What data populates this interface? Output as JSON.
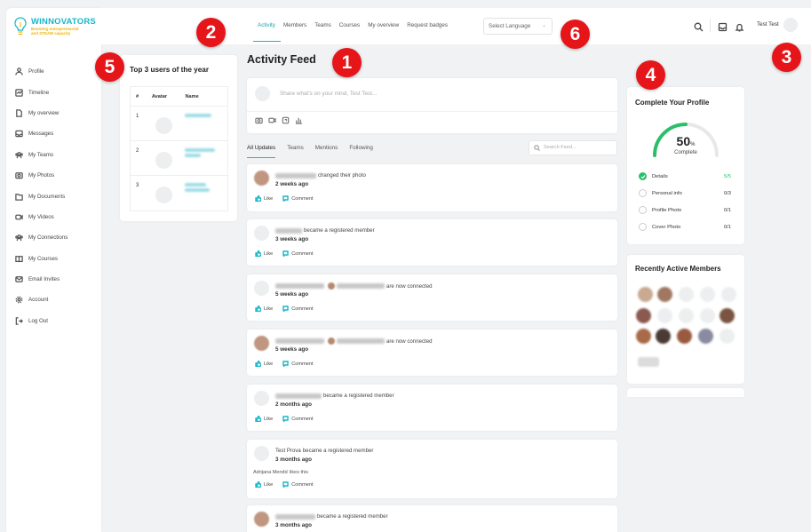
{
  "brand": {
    "name": "WINNOVATORS",
    "tagline": "Boosting entrepreneurial and STEAM capacity",
    "color": "#19b6c9",
    "accent": "#f2b400"
  },
  "sidebar": {
    "items": [
      {
        "label": "Profile",
        "icon": "user-icon"
      },
      {
        "label": "Timeline",
        "icon": "timeline-icon"
      },
      {
        "label": "My overview",
        "icon": "document-icon"
      },
      {
        "label": "Messages",
        "icon": "inbox-icon"
      },
      {
        "label": "My Teams",
        "icon": "teams-icon"
      },
      {
        "label": "My Photos",
        "icon": "photos-icon"
      },
      {
        "label": "My Documents",
        "icon": "folder-icon"
      },
      {
        "label": "My Videos",
        "icon": "video-icon"
      },
      {
        "label": "My Connections",
        "icon": "connections-icon"
      },
      {
        "label": "My Courses",
        "icon": "book-icon"
      },
      {
        "label": "Email Invites",
        "icon": "mail-icon"
      },
      {
        "label": "Account",
        "icon": "gear-icon"
      },
      {
        "label": "Log Out",
        "icon": "logout-icon"
      }
    ]
  },
  "topnav": {
    "tabs": [
      "Activity",
      "Members",
      "Teams",
      "Courses",
      "My overview",
      "Request badges"
    ],
    "active": "Activity",
    "language_placeholder": "Select Language",
    "user_name": "Test Test"
  },
  "badges": [
    "1",
    "2",
    "3",
    "4",
    "5",
    "6"
  ],
  "top_users": {
    "title": "Top 3 users of the year",
    "headers": [
      "#",
      "Avatar",
      "Name"
    ],
    "ranks": [
      "1",
      "2",
      "3"
    ]
  },
  "feed": {
    "title": "Activity Feed",
    "composer_placeholder": "Share what's on your mind, Test Test...",
    "subtabs": [
      "All Updates",
      "Teams",
      "Mentions",
      "Following"
    ],
    "search_placeholder": "Search Feed...",
    "like_label": "Like",
    "comment_label": "Comment",
    "posts": [
      {
        "action": "changed their photo",
        "time": "2 weeks ago"
      },
      {
        "action": "became a registered member",
        "time": "3 weeks ago"
      },
      {
        "action": "are now connected",
        "time": "5 weeks ago"
      },
      {
        "action": "are now connected",
        "time": "5 weeks ago"
      },
      {
        "action": "became a registered member",
        "time": "2 months ago"
      },
      {
        "name": "Test Prova",
        "action": "became a registered member",
        "time": "3 months ago",
        "likes": "Adrijana Mendić likes this"
      },
      {
        "action": "became a registered member",
        "time": "3 months ago"
      }
    ]
  },
  "profile_completion": {
    "title": "Complete Your Profile",
    "percent": 50,
    "percent_sign": "%",
    "complete_label": "Complete",
    "gauge_color": "#2bbf6a",
    "rows": [
      {
        "label": "Details",
        "value": "5/5",
        "done": true
      },
      {
        "label": "Personal info",
        "value": "0/3",
        "done": false
      },
      {
        "label": "Profile Photo",
        "value": "0/1",
        "done": false
      },
      {
        "label": "Cover Photo",
        "value": "0/1",
        "done": false
      }
    ]
  },
  "active_members": {
    "title": "Recently Active Members"
  }
}
